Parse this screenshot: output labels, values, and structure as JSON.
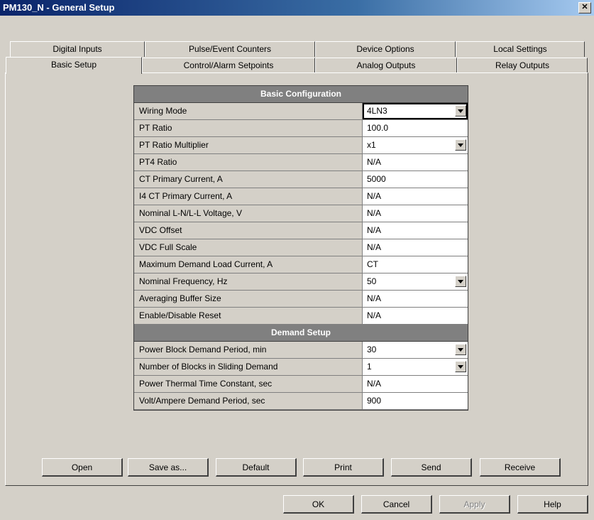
{
  "window": {
    "title": "PM130_N - General Setup",
    "close_glyph": "✕"
  },
  "tabs": {
    "row_back": [
      "Digital Inputs",
      "Pulse/Event Counters",
      "Device Options",
      "Local Settings"
    ],
    "row_front": [
      "Basic Setup",
      "Control/Alarm Setpoints",
      "Analog Outputs",
      "Relay Outputs"
    ],
    "selected": "Basic Setup"
  },
  "sections": [
    {
      "title": "Basic Configuration",
      "rows": [
        {
          "label": "Wiring Mode",
          "value": "4LN3",
          "dropdown": true,
          "selected": true
        },
        {
          "label": "PT Ratio",
          "value": "100.0",
          "dropdown": false
        },
        {
          "label": "PT Ratio Multiplier",
          "value": "x1",
          "dropdown": true
        },
        {
          "label": "PT4 Ratio",
          "value": "N/A",
          "dropdown": false
        },
        {
          "label": "CT Primary Current, A",
          "value": "5000",
          "dropdown": false
        },
        {
          "label": "I4 CT Primary Current, A",
          "value": "N/A",
          "dropdown": false
        },
        {
          "label": "Nominal L-N/L-L Voltage, V",
          "value": "N/A",
          "dropdown": false
        },
        {
          "label": "VDC Offset",
          "value": "N/A",
          "dropdown": false
        },
        {
          "label": "VDC Full Scale",
          "value": "N/A",
          "dropdown": false
        },
        {
          "label": "Maximum Demand Load Current, A",
          "value": "CT",
          "dropdown": false
        },
        {
          "label": "Nominal Frequency, Hz",
          "value": "50",
          "dropdown": true
        },
        {
          "label": "Averaging Buffer Size",
          "value": "N/A",
          "dropdown": false
        },
        {
          "label": "Enable/Disable Reset",
          "value": "N/A",
          "dropdown": false
        }
      ]
    },
    {
      "title": "Demand Setup",
      "rows": [
        {
          "label": "Power Block Demand Period, min",
          "value": "30",
          "dropdown": true
        },
        {
          "label": "Number of Blocks in Sliding Demand",
          "value": "1",
          "dropdown": true
        },
        {
          "label": "Power Thermal Time Constant, sec",
          "value": "N/A",
          "dropdown": false
        },
        {
          "label": "Volt/Ampere Demand Period, sec",
          "value": "900",
          "dropdown": false
        }
      ]
    }
  ],
  "actions": {
    "open": "Open",
    "save_as": "Save as...",
    "default": "Default",
    "print": "Print",
    "send": "Send",
    "receive": "Receive"
  },
  "dialog": {
    "ok": "OK",
    "cancel": "Cancel",
    "apply": "Apply",
    "help": "Help"
  }
}
